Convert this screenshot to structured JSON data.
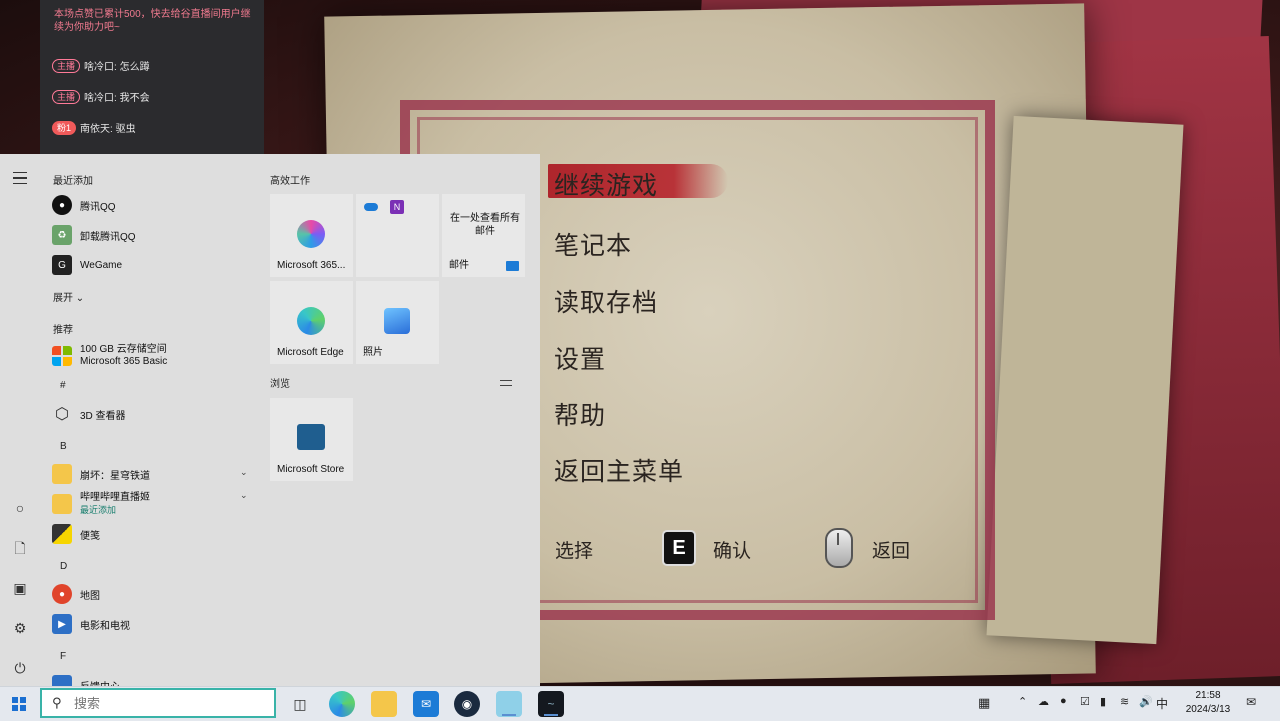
{
  "game": {
    "menu": [
      "继续游戏",
      "笔记本",
      "读取存档",
      "设置",
      "帮助",
      "返回主菜单"
    ],
    "hints": {
      "select": "选择",
      "confirm_key": "E",
      "confirm": "确认",
      "back": "返回"
    }
  },
  "chat": {
    "system_message": "本场点赞已累计500，快去给谷直播间用户继续为你助力吧~",
    "messages": [
      {
        "badge": "主播",
        "text": "啥冷口: 怎么蹲"
      },
      {
        "badge": "主播",
        "text": "啥冷口: 我不会"
      },
      {
        "badge": "粉1",
        "text": "南依天: 驱虫"
      }
    ]
  },
  "start_menu": {
    "recent_header": "最近添加",
    "recent": [
      "腾讯QQ",
      "卸载腾讯QQ",
      "WeGame"
    ],
    "expand": "展开",
    "recommended_header": "推荐",
    "recommended": {
      "line1": "100 GB 云存储空间",
      "line2": "Microsoft 365 Basic"
    },
    "groups": [
      {
        "letter": "#",
        "apps": [
          "3D 查看器"
        ]
      },
      {
        "letter": "B",
        "apps": [
          "崩坏：星穹铁道",
          "哔哩哔哩直播姬",
          "便笺"
        ],
        "sub": "最近添加"
      },
      {
        "letter": "D",
        "apps": [
          "地图",
          "电影和电视"
        ]
      },
      {
        "letter": "F",
        "apps": [
          "反馈中心"
        ]
      }
    ],
    "tiles_group1": "高效工作",
    "tiles": {
      "m365": "Microsoft 365...",
      "mail_text": "在一处查看所有邮件",
      "mail": "邮件",
      "edge": "Microsoft Edge",
      "photos": "照片"
    },
    "tiles_group2": "浏览",
    "store": "Microsoft Store"
  },
  "taskbar": {
    "search_placeholder": "搜索",
    "ime": "中",
    "time": "21:58",
    "date": "2024/3/13"
  },
  "colors": {
    "accent": "#39b3a8",
    "start_bg": "#dedede",
    "chat_bg": "#2b2b2e",
    "brush_red": "#b0141e"
  }
}
